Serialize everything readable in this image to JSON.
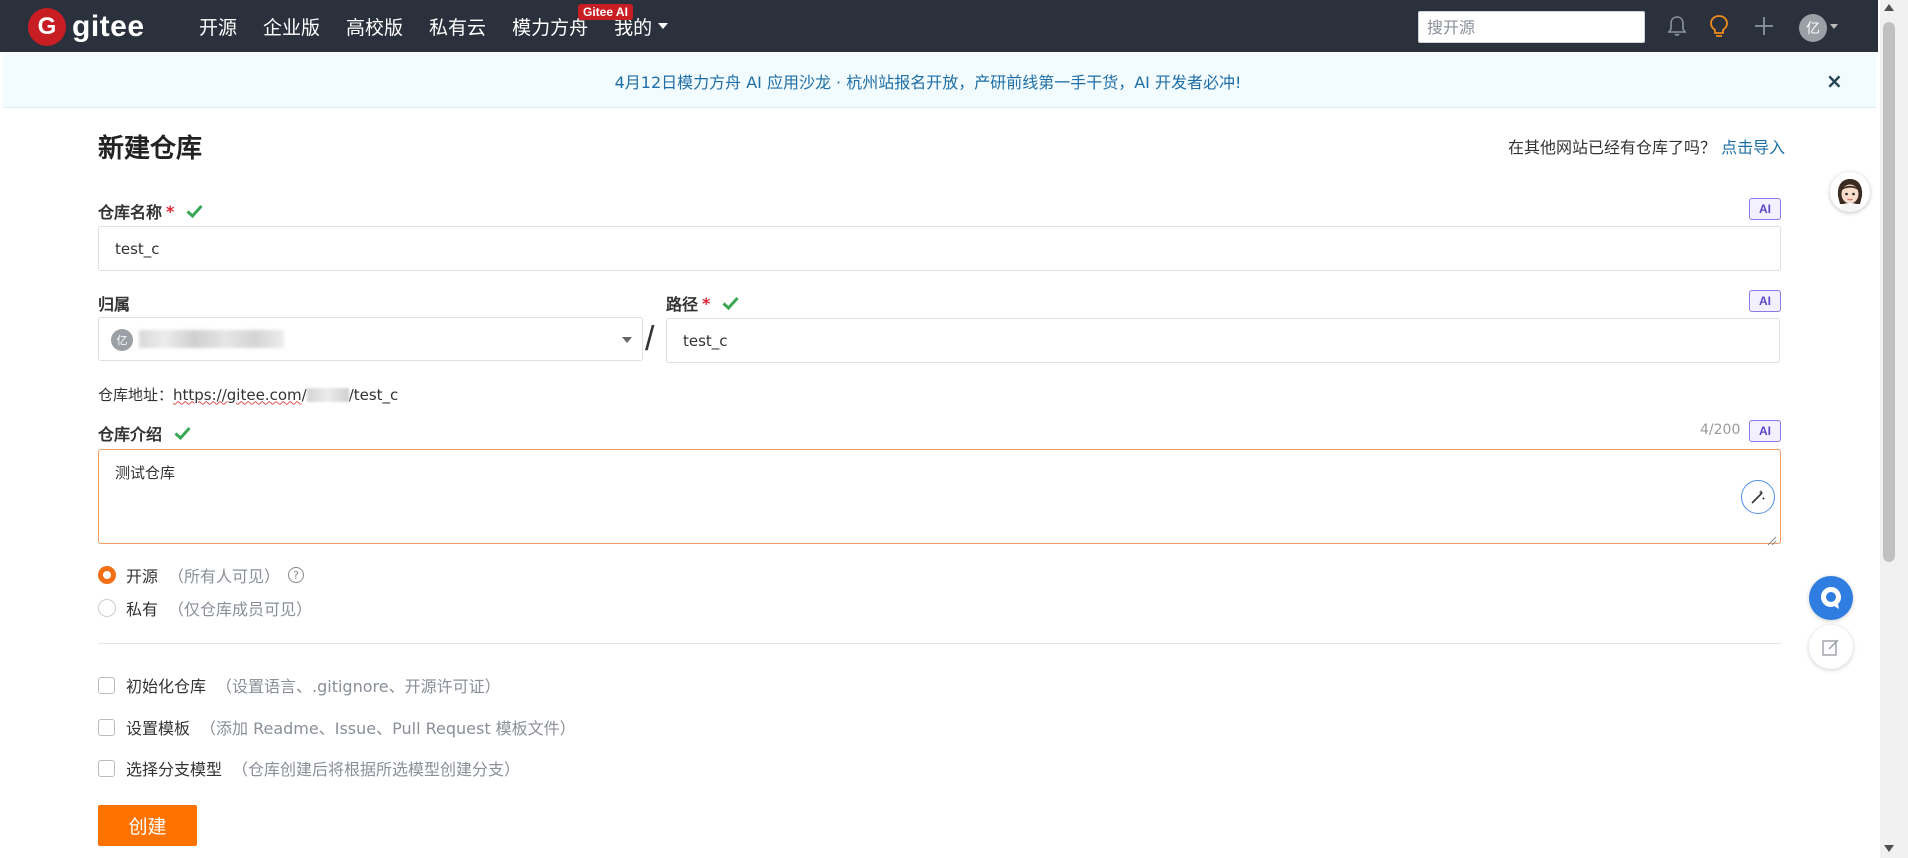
{
  "header": {
    "logo_letter": "G",
    "logo_text": "gitee",
    "nav": [
      "开源",
      "企业版",
      "高校版",
      "私有云",
      "模力方舟",
      "我的"
    ],
    "hot_badge": "Gitee AI",
    "search_placeholder": "搜开源",
    "avatar_initial": "亿",
    "icons": [
      "bell-icon",
      "lightbulb-icon",
      "plus-icon"
    ]
  },
  "announcement": {
    "text": "4月12日模力方舟 AI 应用沙龙 · 杭州站报名开放，产研前线第一手干货，AI 开发者必冲!",
    "close": "×"
  },
  "form": {
    "title": "新建仓库",
    "import_prompt": "在其他网站已经有仓库了吗？",
    "import_link": "点击导入",
    "ai_badge": "AI",
    "required_mark": "*",
    "name_label": "仓库名称",
    "name_value": "test_c",
    "owner_label": "归属",
    "owner_avatar": "亿",
    "slash": "/",
    "path_label": "路径",
    "path_value": "test_c",
    "url_prefix": "仓库地址：",
    "url_host": "https://gitee.com",
    "url_sep": "/",
    "url_repo": "/test_c",
    "desc_label": "仓库介绍",
    "desc_counter": "4/200",
    "desc_value": "测试仓库",
    "visibility": [
      {
        "label": "开源",
        "hint": "（所有人可见）",
        "selected": true
      },
      {
        "label": "私有",
        "hint": "（仅仓库成员可见）",
        "selected": false
      }
    ],
    "help": "?",
    "options": [
      {
        "label": "初始化仓库",
        "hint": "（设置语言、.gitignore、开源许可证）"
      },
      {
        "label": "设置模板",
        "hint": "（添加 Readme、Issue、Pull Request 模板文件）"
      },
      {
        "label": "选择分支模型",
        "hint": "（仓库创建后将根据所选模型创建分支）"
      }
    ],
    "submit_label": "创建"
  },
  "colors": {
    "header_bg": "#2a313c",
    "accent": "#fe7300",
    "link": "#1e6ea7",
    "valid_check": "#3aa757"
  }
}
